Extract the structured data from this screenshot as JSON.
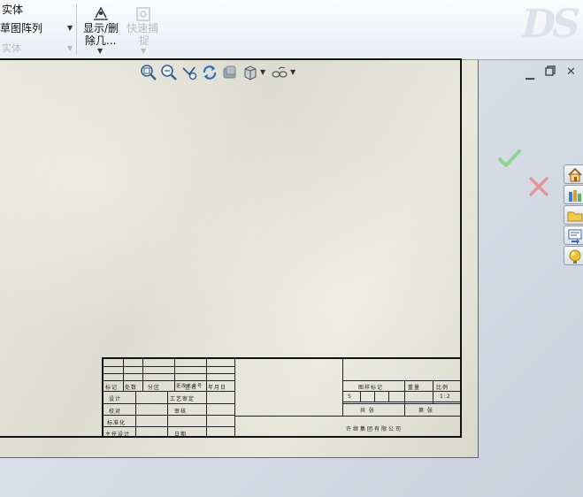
{
  "ribbon": {
    "item_solid": "实体",
    "item_sketch_pattern": "草图阵列",
    "item_faded": "实体",
    "display_delete_label_1": "显示/删",
    "display_delete_label_2": "除几...",
    "quick_snap_label_1": "快速捕",
    "quick_snap_label_2": "捉"
  },
  "hud": {
    "icons": [
      "zoom-to-fit-icon",
      "zoom-to-area-icon",
      "previous-view-icon",
      "rebuild-icon",
      "section-view-icon",
      "view-orientation-icon",
      "hide-show-items-icon"
    ]
  },
  "window": {
    "minimize": "▁",
    "restore": "🗗",
    "close": "✕"
  },
  "task_pane": {
    "tabs": [
      "home-tab-icon",
      "design-library-icon",
      "file-explorer-icon",
      "view-palette-icon",
      "appearances-icon"
    ]
  },
  "title_block": {
    "row_header": [
      "标记",
      "处数",
      "分区",
      "更改文件号",
      "签名",
      "年月日"
    ],
    "design": "设计",
    "process_review": "工艺审定",
    "proofread": "校对",
    "approve": "审核",
    "standardize": "标准化",
    "chief_design": "主任设计",
    "date_cell": "日期",
    "drawing_mark": "图样标记",
    "weight": "重量",
    "scale": "比例",
    "mark_s": "S",
    "scale_value": "1:2",
    "total_sheets": "共 张",
    "sheet_no": "第 张",
    "company": "许继集团有限公司"
  },
  "colors": {
    "ok_green": "#7fcf7f",
    "cancel_red": "#e07a7a"
  }
}
